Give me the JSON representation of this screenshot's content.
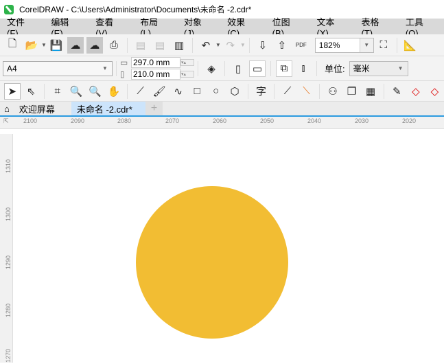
{
  "window": {
    "title": "CorelDRAW - C:\\Users\\Administrator\\Documents\\未命名 -2.cdr*"
  },
  "menu": [
    "文件(F)",
    "编辑(E)",
    "查看(V)",
    "布局(L)",
    "对象(J)",
    "效果(C)",
    "位图(B)",
    "文本(X)",
    "表格(T)",
    "工具(O)"
  ],
  "toolbar": {
    "zoom": "182%",
    "pdf_label": "PDF"
  },
  "property_bar": {
    "page_size": "A4",
    "width": "297.0 mm",
    "height": "210.0 mm",
    "unit_label": "单位:",
    "unit": "毫米"
  },
  "tabs": {
    "home": "欢迎屏幕",
    "document": "未命名 -2.cdr*",
    "add": "+"
  },
  "rulers": {
    "horizontal": [
      "2100",
      "2090",
      "2080",
      "2070",
      "2060",
      "2050",
      "2040",
      "2030",
      "2020"
    ],
    "vertical": [
      "1310",
      "1300",
      "1290",
      "1280",
      "1270"
    ]
  },
  "canvas": {
    "shape": "ellipse",
    "fill": "#F2BD33"
  }
}
